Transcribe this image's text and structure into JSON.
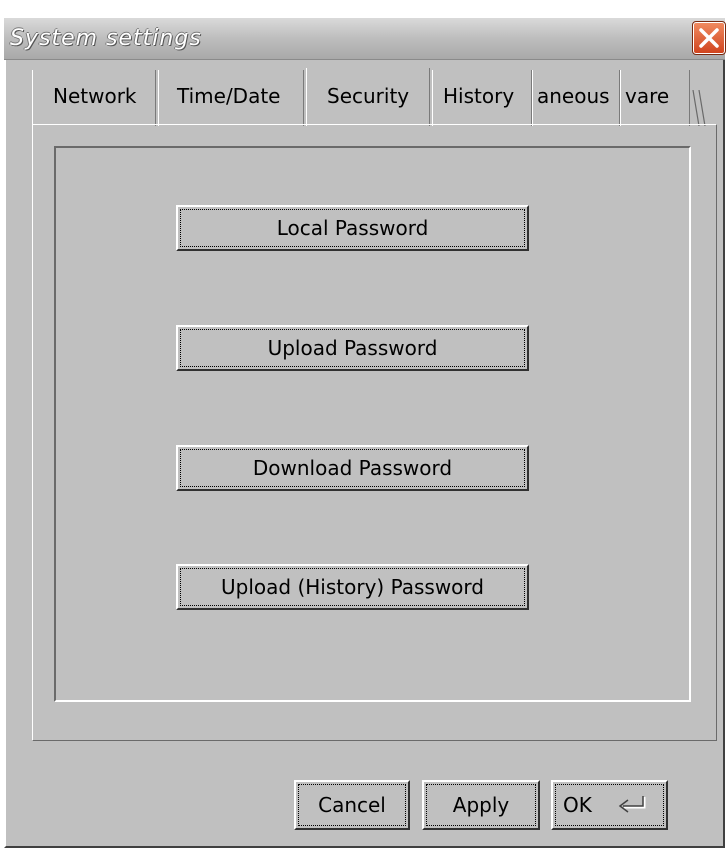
{
  "window": {
    "title": "System settings"
  },
  "tabs": [
    {
      "label": "Network",
      "active": false
    },
    {
      "label": "Time/Date",
      "active": false
    },
    {
      "label": "Security",
      "active": true
    },
    {
      "label": "History",
      "active": false
    },
    {
      "label": "aneous",
      "active": false
    },
    {
      "label": "vare",
      "active": false
    }
  ],
  "security": {
    "local_password": "Local Password",
    "upload_password": "Upload Password",
    "download_password": "Download Password",
    "upload_history_password": "Upload (History) Password"
  },
  "footer": {
    "cancel_label": "Cancel",
    "apply_label": "Apply",
    "ok_label": "OK"
  },
  "icons": {
    "close": "close-icon",
    "enter": "enter-key-icon"
  },
  "colors": {
    "dialog_bg": "#c0c0c0",
    "close_button": "#d0441e"
  }
}
